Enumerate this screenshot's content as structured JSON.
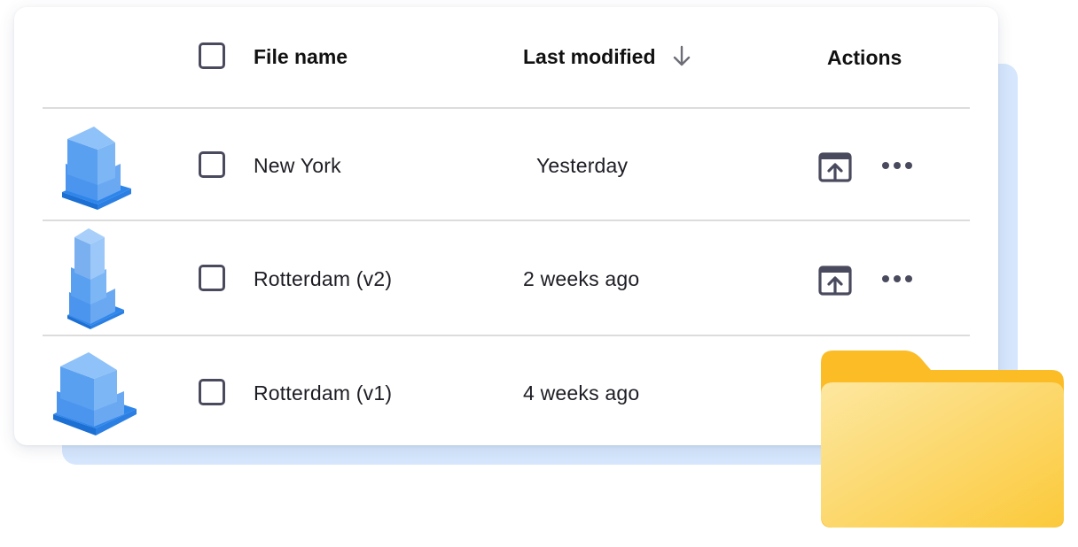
{
  "table": {
    "headers": {
      "file_name": "File name",
      "last_modified": "Last modified",
      "actions": "Actions"
    },
    "sort_icon": "arrow-down-icon",
    "rows": [
      {
        "name": "New York",
        "modified": "Yesterday",
        "thumbnail": "building-model-icon",
        "actions": [
          "open-in-icon",
          "more-options-icon"
        ]
      },
      {
        "name": "Rotterdam (v2)",
        "modified": "2 weeks ago",
        "thumbnail": "building-model-icon",
        "actions": [
          "open-in-icon",
          "more-options-icon"
        ]
      },
      {
        "name": "Rotterdam (v1)",
        "modified": "4 weeks ago",
        "thumbnail": "building-model-icon",
        "actions": []
      }
    ]
  },
  "decorations": {
    "folder_icon": "folder-icon"
  },
  "colors": {
    "accent_blue": "#2f86ea",
    "backing_card": "#d6e7fd",
    "folder_yellow": "#fbbf24",
    "checkbox_border": "#4a4a5e"
  }
}
